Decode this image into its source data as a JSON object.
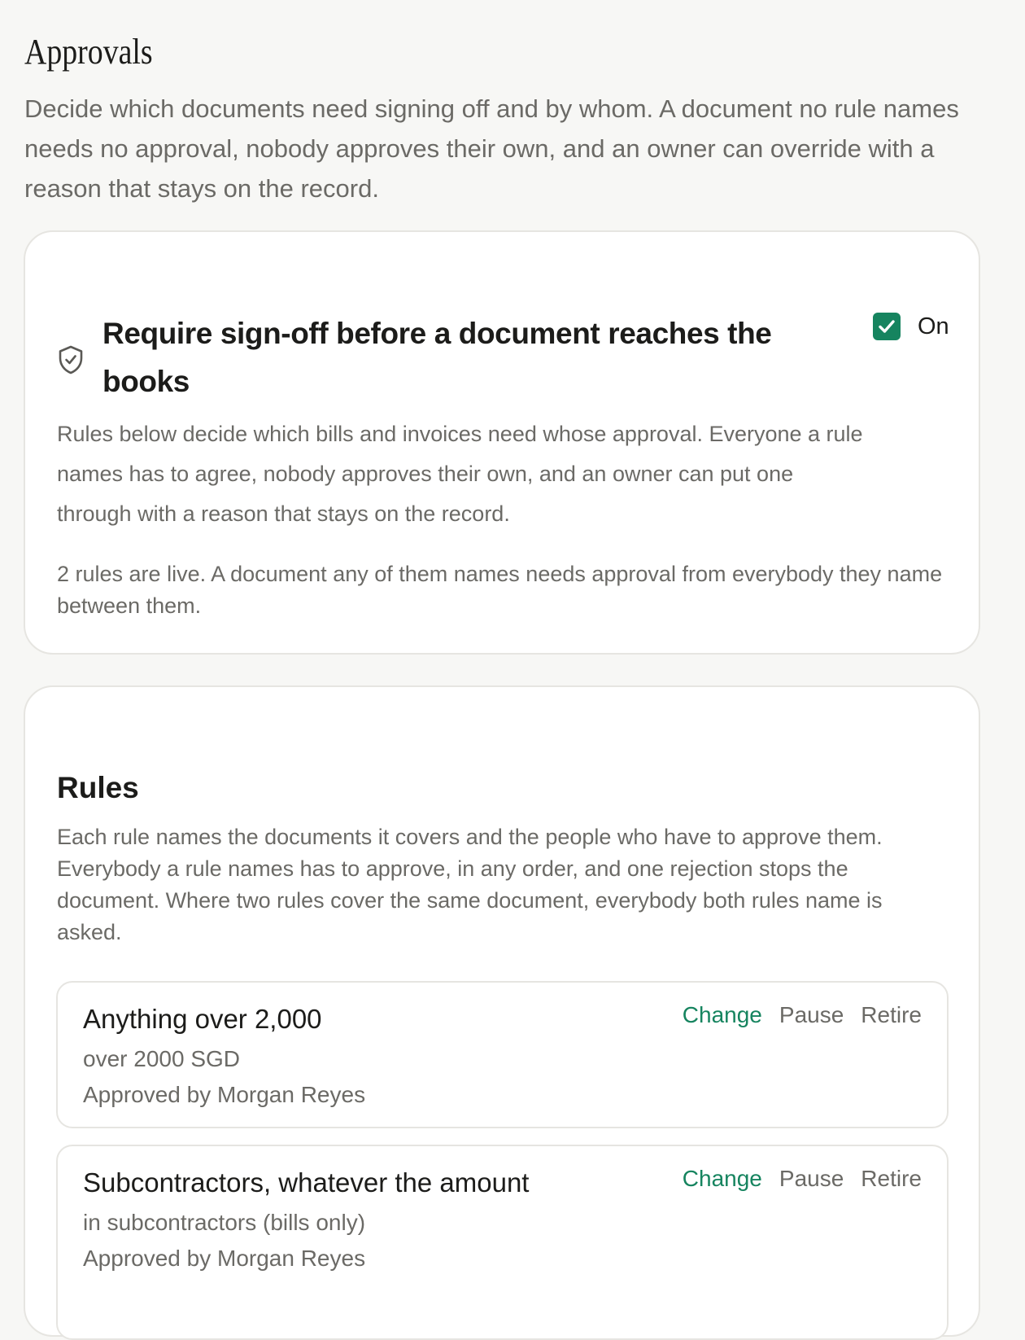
{
  "page": {
    "title": "Approvals",
    "intro": "Decide which documents need signing off and by whom. A document no rule names needs no approval, nobody approves their own, and an owner can override with a reason that stays on the record."
  },
  "signoff": {
    "icon": "shield-check-icon",
    "heading": "Require sign-off before a document reaches the books",
    "toggle_checked": true,
    "toggle_label": "On",
    "description": "Rules below decide which bills and invoices need whose approval. Everyone a rule names has to agree, nobody approves their own, and an owner can put one through with a reason that stays on the record.",
    "status": "2 rules are live. A document any of them names needs approval from everybody they name between them."
  },
  "rules": {
    "heading": "Rules",
    "description": "Each rule names the documents it covers and the people who have to approve them. Everybody a rule names has to approve, in any order, and one rejection stops the document. Where two rules cover the same document, everybody both rules name is asked.",
    "items": [
      {
        "title": "Anything over 2,000",
        "scope": "over 2000 SGD",
        "approver": "Approved by Morgan Reyes",
        "change_label": "Change",
        "pause_label": "Pause",
        "retire_label": "Retire"
      },
      {
        "title": "Subcontractors, whatever the amount",
        "scope": "in subcontractors (bills only)",
        "approver": "Approved by Morgan Reyes",
        "change_label": "Change",
        "pause_label": "Pause",
        "retire_label": "Retire"
      }
    ]
  },
  "colors": {
    "accent": "#16845f",
    "background": "#f7f7f5",
    "muted_text": "#6b6a66"
  }
}
